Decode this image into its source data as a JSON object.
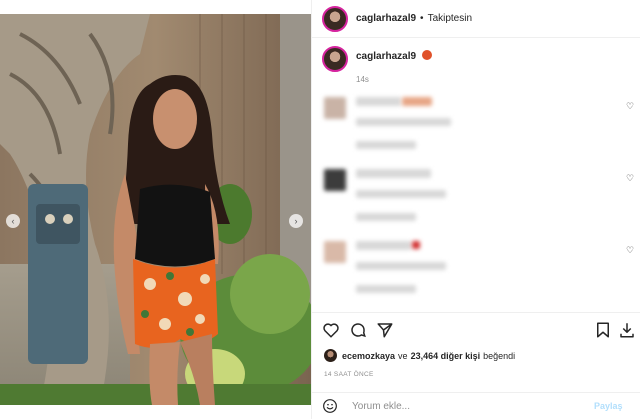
{
  "header": {
    "username": "caglarhazal9",
    "separator": "•",
    "follow_status": "Takiptesin"
  },
  "caption": {
    "username": "caglarhazal9",
    "emoji": "flame-emoji",
    "time": "14s"
  },
  "comments": [
    {
      "text": "blurred comment",
      "action": "heart-outline"
    },
    {
      "text": "blurred comment",
      "action": "heart-outline"
    },
    {
      "text": "blurred comment",
      "action": "heart-outline"
    }
  ],
  "actions": {
    "like": "heart-icon",
    "comment": "comment-icon",
    "share": "send-icon",
    "save": "bookmark-icon",
    "download": "download-icon"
  },
  "likes": {
    "first_user": "ecemozkaya",
    "middle": "ve",
    "count": "23,464 diğer kişi",
    "suffix": "beğendi"
  },
  "posted_ago": "14 SAAT ÖNCE",
  "comment_box": {
    "placeholder": "Yorum ekle...",
    "submit_label": "Paylaş"
  },
  "colors": {
    "accent_link": "#b2dffc",
    "text": "#262626",
    "muted": "#8e8e8e",
    "story_ring": "#d6249f"
  }
}
